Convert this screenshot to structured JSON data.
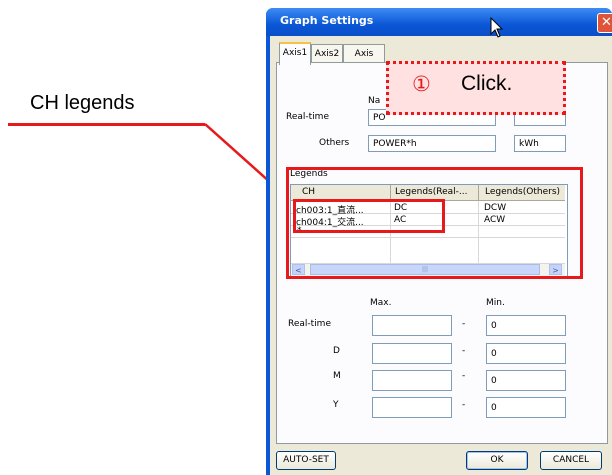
{
  "annotation": {
    "label": "CH legends",
    "callout_number": "①",
    "callout_text": "Click."
  },
  "dialog": {
    "title": "Graph Settings",
    "close_glyph": "✕",
    "tabs": [
      {
        "label": "Axis1",
        "active": true
      },
      {
        "label": "Axis2",
        "active": false
      },
      {
        "label": "Axis",
        "active": false
      }
    ],
    "name_section": {
      "name_header": "Na",
      "realtime_label": "Real-time",
      "realtime_name": "PO",
      "others_label": "Others",
      "others_name": "POWER*h",
      "others_unit": "kWh"
    },
    "legends": {
      "group_label": "Legends",
      "columns": [
        "CH",
        "Legends(Real-...",
        "Legends(Others)"
      ],
      "rows": [
        {
          "ch": "ch003:1_直流...",
          "realtime": "DC",
          "others": "DCW"
        },
        {
          "ch": "ch004:1_交流...",
          "realtime": "AC",
          "others": "ACW"
        }
      ],
      "new_row_marker": "*",
      "scroll_left": "<",
      "scroll_right": ">",
      "scroll_thumb": "|||"
    },
    "range": {
      "max_header": "Max.",
      "min_header": "Min.",
      "rows": [
        {
          "label": "Real-time",
          "max": "",
          "sep": "-",
          "min": "0"
        },
        {
          "label": "D",
          "max": "",
          "sep": "-",
          "min": "0"
        },
        {
          "label": "M",
          "max": "",
          "sep": "-",
          "min": "0"
        },
        {
          "label": "Y",
          "max": "",
          "sep": "-",
          "min": "0"
        }
      ]
    },
    "buttons": {
      "auto_set": "AUTO-SET",
      "ok": "OK",
      "cancel": "CANCEL"
    }
  },
  "colors": {
    "annotation_red": "#e8191b",
    "titlebar_blue": "#0a58d8",
    "dialog_face": "#ece9d8"
  }
}
